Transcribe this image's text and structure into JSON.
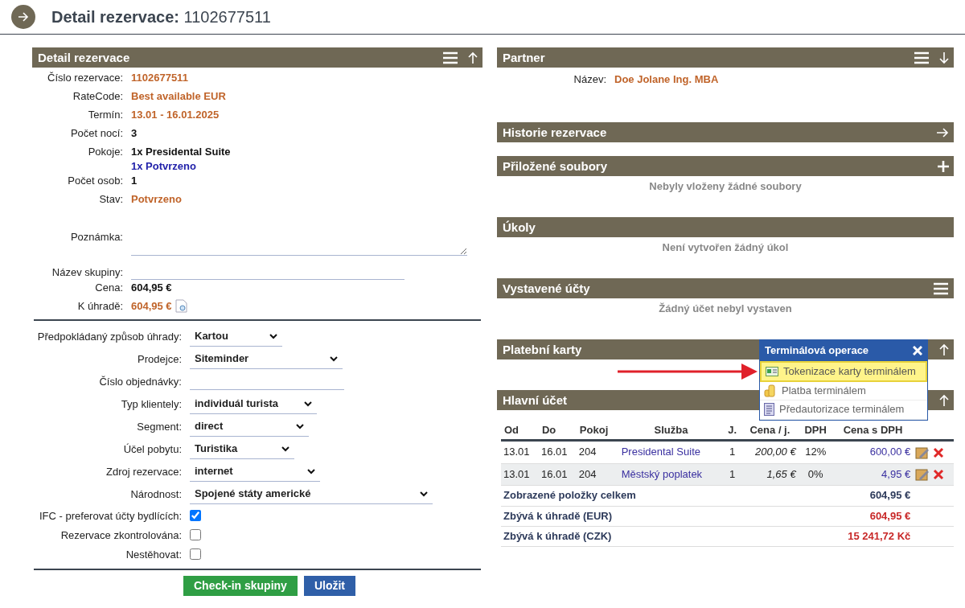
{
  "page_title": {
    "label": "Detail rezervace:",
    "number": "1102677511"
  },
  "detail": {
    "title": "Detail rezervace",
    "fields": [
      {
        "label": "Číslo rezervace:",
        "kind": "accent",
        "value": "1102677511"
      },
      {
        "label": "RateCode:",
        "kind": "accent",
        "value": "Best available EUR"
      },
      {
        "label": "Termín:",
        "kind": "accent",
        "value": "13.01 - 16.01.2025"
      },
      {
        "label": "Počet nocí:",
        "kind": "plain",
        "value": "3"
      },
      {
        "label": "Pokoje:",
        "kind": "plain",
        "value": "1x Presidental Suite",
        "sub": "1x Potvrzeno"
      },
      {
        "label": "Počet osob:",
        "kind": "plain",
        "value": "1"
      },
      {
        "label": "Stav:",
        "kind": "accent",
        "value": "Potvrzeno"
      },
      {
        "label": "Poznámka:",
        "kind": "textarea"
      },
      {
        "label": "Název skupiny:",
        "kind": "input"
      },
      {
        "label": "Cena:",
        "kind": "plain",
        "value": "604,95 €"
      },
      {
        "label": "K úhradě:",
        "kind": "preview",
        "value": "604,95 €"
      }
    ],
    "options": [
      {
        "label": "Předpokládaný způsob úhrady:",
        "kind": "select",
        "value": "Kartou"
      },
      {
        "label": "Prodejce:",
        "kind": "select",
        "value": "Siteminder"
      },
      {
        "label": "Číslo objednávky:",
        "kind": "input"
      },
      {
        "label": "Typ klientely:",
        "kind": "select",
        "value": "individuál turista"
      },
      {
        "label": "Segment:",
        "kind": "select",
        "value": "direct"
      },
      {
        "label": "Účel pobytu:",
        "kind": "select",
        "value": "Turistika"
      },
      {
        "label": "Zdroj rezervace:",
        "kind": "select",
        "value": "internet"
      },
      {
        "label": "Národnost:",
        "kind": "select",
        "value": "Spojené státy americké"
      },
      {
        "label": "IFC - preferovat účty bydlících:",
        "kind": "checkbox",
        "checked": true
      },
      {
        "label": "Rezervace zkontrolována:",
        "kind": "checkbox",
        "checked": false
      },
      {
        "label": "Nestěhovat:",
        "kind": "checkbox",
        "checked": false
      }
    ],
    "buttons": [
      {
        "label": "Check-in skupiny",
        "kind": "success"
      },
      {
        "label": "Uložit",
        "kind": "primary"
      }
    ]
  },
  "panels": [
    {
      "title": "Partner",
      "kind": "fields",
      "fields": [
        {
          "label": "Název:",
          "value": "Doe Jolane Ing. MBA"
        }
      ]
    },
    {
      "title": "Historie rezervace",
      "kind": "none"
    },
    {
      "title": "Přiložené soubory",
      "kind": "empty",
      "message": "Nebyly vloženy žádné soubory"
    },
    {
      "title": "Úkoly",
      "kind": "empty",
      "message": "Není vytvořen žádný úkol"
    },
    {
      "title": "Vystavené účty",
      "kind": "empty",
      "message": "Žádný účet nebyl vystaven"
    },
    {
      "title": "Platební karty",
      "kind": "cards"
    },
    {
      "title": "Hlavní účet",
      "kind": "table",
      "columns": [
        "Od",
        "Do",
        "Pokoj",
        "Služba",
        "J.",
        "Cena / j.",
        "DPH",
        "Cena s DPH"
      ],
      "rows": [
        {
          "cells": [
            "13.01",
            "16.01",
            "204",
            "Presidental Suite",
            "1",
            "200,00 €",
            "12%",
            "600,00 €"
          ]
        },
        {
          "cells": [
            "13.01",
            "16.01",
            "204",
            "Městský poplatek",
            "1",
            "1,65 €",
            "0%",
            "4,95 €"
          ]
        }
      ],
      "totals": [
        {
          "label": "Zobrazené položky celkem",
          "value": "604,95 €",
          "kind": "plain"
        },
        {
          "label": "Zbývá k úhradě (EUR)",
          "value": "604,95 €",
          "kind": "danger"
        },
        {
          "label": "Zbývá k úhradě (CZK)",
          "value": "15 241,72 Kč",
          "kind": "danger"
        }
      ]
    }
  ],
  "popup": {
    "title": "Terminálová operace",
    "items": [
      {
        "label": "Tokenizace karty terminálem",
        "selected": true
      },
      {
        "label": "Platba terminálem",
        "selected": false
      },
      {
        "label": "Předautorizace terminálem",
        "selected": false
      }
    ]
  }
}
